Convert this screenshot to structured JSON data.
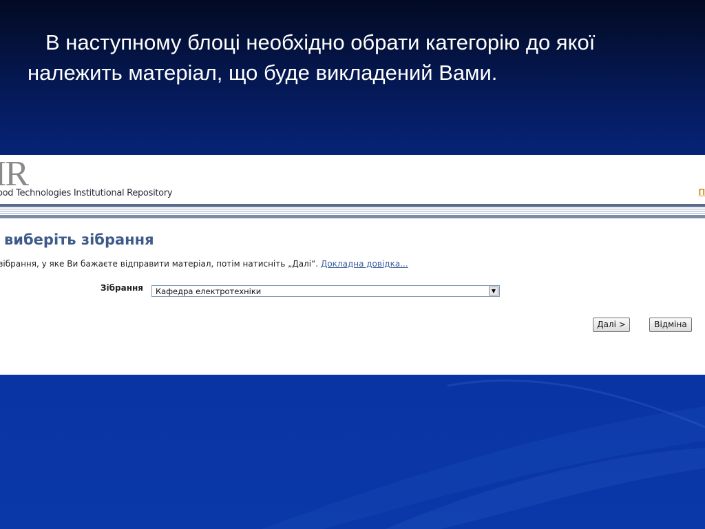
{
  "slide": {
    "line1": "В наступному блоці необхідно обрати категорію до якої",
    "line2": "належить матеріал, що буде викладений Вами."
  },
  "screenshot": {
    "logo_text": "IR",
    "repo_name": "ood Technologies Institutional Repository",
    "top_link": "П",
    "page_title": "виберіть зібрання",
    "instruction": "зібрання, у яке Ви бажаєте відправити матеріал, потім натисніть „Далі“.",
    "help_link": "Докладна довідка...",
    "field_label": "Зібрання",
    "select_value": "Кафедра електротехніки",
    "next_button": "Далі >",
    "cancel_button": "Відміна"
  }
}
